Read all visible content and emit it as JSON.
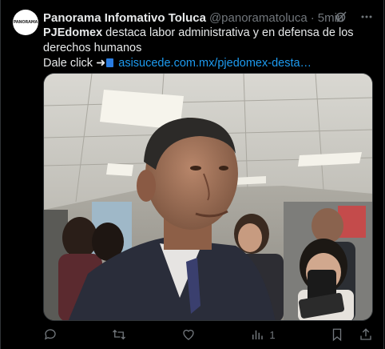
{
  "tweet": {
    "author_name": "Panorama Infomativo Toluca",
    "handle": "@panoramatoluca",
    "separator": "·",
    "time": "5min",
    "avatar_text": "PANORAMA",
    "text_bold": "PJEdomex",
    "text_rest": " destaca labor administrativa y en defensa de los derechos humanos",
    "cta": "Dale click ",
    "arrow": "➜",
    "link_text": "asisucede.com.mx/pjedomex-desta…",
    "media_alt": "Man in suit speaking to reporters holding phones in a hallway"
  },
  "actions": {
    "reply": "",
    "retweet": "",
    "like": "",
    "views": "1",
    "bookmark": "",
    "share": ""
  },
  "colors": {
    "background": "#000000",
    "text": "#e7e9ea",
    "muted": "#71767b",
    "link": "#1d9bf0"
  }
}
